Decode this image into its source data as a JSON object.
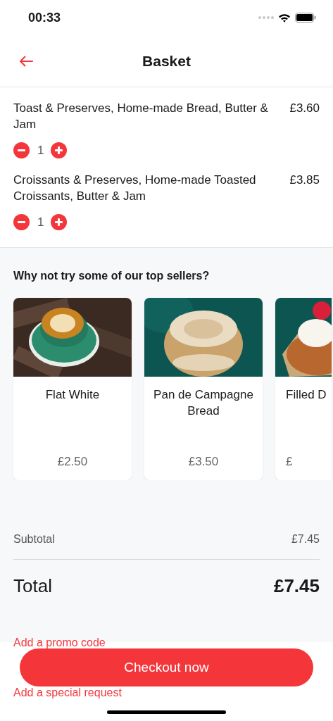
{
  "status_bar": {
    "time": "00:33"
  },
  "header": {
    "title": "Basket"
  },
  "basket_items": [
    {
      "name": "Toast & Preserves, Home-made Bread, Butter & Jam",
      "price": "£3.60",
      "quantity": "1"
    },
    {
      "name": "Croissants & Preserves, Home-made Toasted Croissants, Butter & Jam",
      "price": "£3.85",
      "quantity": "1"
    }
  ],
  "top_sellers": {
    "title": "Why not try some of our top sellers?",
    "products": [
      {
        "kind": "coffee",
        "name": "Flat White",
        "price": "£2.50"
      },
      {
        "kind": "bread",
        "name": "Pan de Campagne Bread",
        "price": "£3.50"
      },
      {
        "kind": "pastry",
        "name": "Filled D",
        "price": "£"
      }
    ]
  },
  "summary": {
    "subtotal_label": "Subtotal",
    "subtotal": "£7.45",
    "total_label": "Total",
    "total": "£7.45"
  },
  "links": [
    "Add a promo code",
    "Add a special request"
  ],
  "checkout_button": "Checkout now"
}
